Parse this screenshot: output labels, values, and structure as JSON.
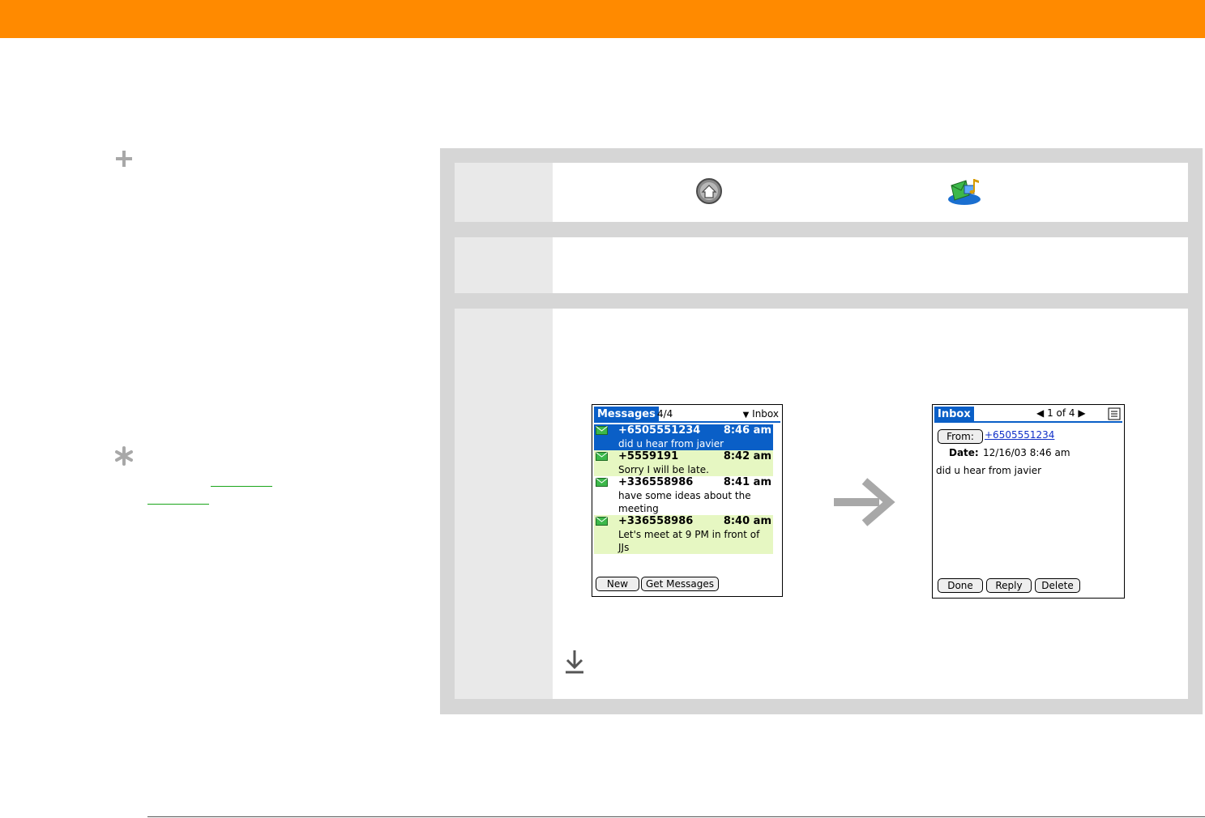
{
  "icons": {
    "tip": "plus-icon",
    "did_you_know": "asterisk-icon",
    "home": "home-icon",
    "app": "sms-app-icon",
    "transition": "arrow-right-icon",
    "done": "download-arrow-icon"
  },
  "colors": {
    "header_bar": "#ff8a00",
    "palm_accent": "#0a5fc7",
    "row_highlight": "#e6f7c2",
    "link": "#1aa51a"
  },
  "messages_screen": {
    "title": "Messages",
    "count": "4/4",
    "folder": "Inbox",
    "messages": [
      {
        "sender": "+6505551234",
        "time": "8:46 am",
        "preview": "did u hear from javier"
      },
      {
        "sender": "+5559191",
        "time": "8:42 am",
        "preview": "Sorry I will be late."
      },
      {
        "sender": "+336558986",
        "time": "8:41 am",
        "preview": "have some ideas about the meeting"
      },
      {
        "sender": "+336558986",
        "time": "8:40 am",
        "preview": "Let's meet at 9 PM in front of JJs"
      }
    ],
    "buttons": {
      "new": "New",
      "get_messages": "Get Messages"
    }
  },
  "detail_screen": {
    "title": "Inbox",
    "pager": "1 of 4",
    "from_label": "From:",
    "from_value": "+6505551234",
    "date_label": "Date:",
    "date_value": "12/16/03 8:46 am",
    "body": "did u hear from javier",
    "buttons": {
      "done": "Done",
      "reply": "Reply",
      "delete": "Delete"
    }
  }
}
